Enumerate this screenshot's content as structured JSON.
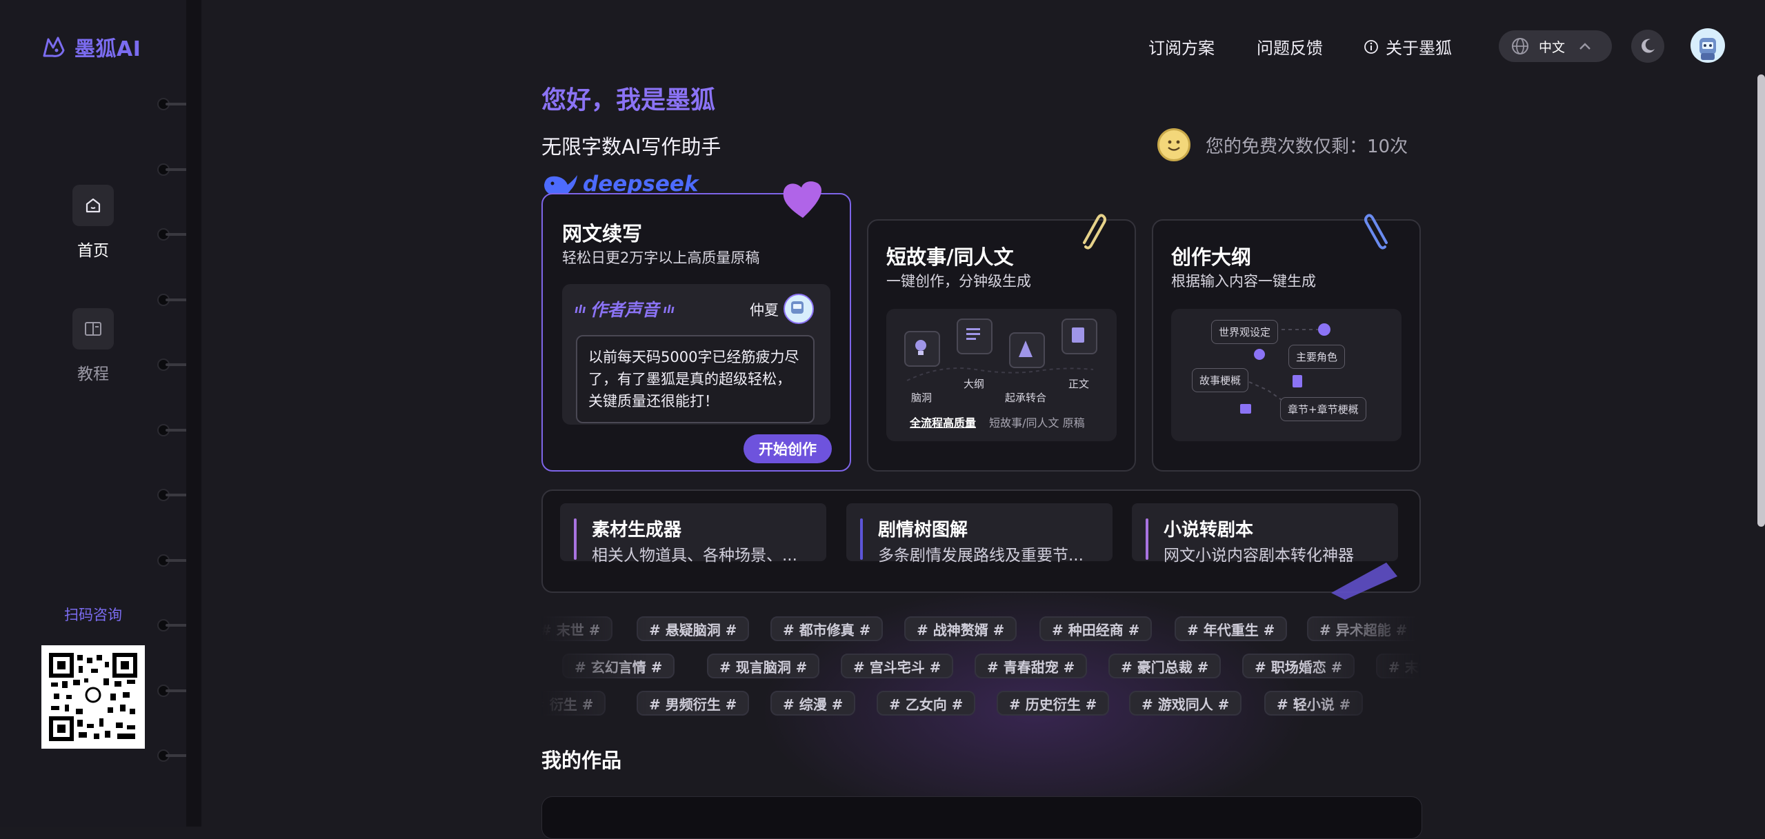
{
  "app": {
    "name": "墨狐AI"
  },
  "header": {
    "subscribe": "订阅方案",
    "feedback": "问题反馈",
    "about": "关于墨狐",
    "language": "中文"
  },
  "sidebar": {
    "items": [
      {
        "label": "首页",
        "icon": "home-icon",
        "active": true
      },
      {
        "label": "教程",
        "icon": "book-icon",
        "active": false
      }
    ],
    "qr_title": "扫码咨询"
  },
  "hero": {
    "greeting": "您好，我是墨狐",
    "subtitle": "无限字数AI写作助手",
    "free_prefix": "您的免费次数仅剩：",
    "free_count": "10次"
  },
  "cards": {
    "continue": {
      "badge": "deepseek",
      "title": "网文续写",
      "subtitle": "轻松日更2万字以上高质量原稿",
      "voice_label": "作者声音",
      "author": "仲夏",
      "quote": "以前每天码5000字已经筋疲力尽了，有了墨狐是真的超级轻松，关键质量还很能打！",
      "button": "开始创作"
    },
    "short": {
      "title": "短故事/同人文",
      "subtitle": "一键创作，分钟级生成",
      "steps": [
        "脑洞",
        "大纲",
        "起承转合",
        "正文"
      ],
      "footer_highlight": "全流程高质量",
      "footer_rest": "短故事/同人文 原稿"
    },
    "outline": {
      "title": "创作大纲",
      "subtitle": "根据输入内容一键生成",
      "nodes": [
        "世界观设定",
        "主要角色",
        "故事梗概",
        "章节+章节梗概"
      ]
    }
  },
  "tools": [
    {
      "title": "素材生成器",
      "desc": "相关人物道具、各种场景、..."
    },
    {
      "title": "剧情树图解",
      "desc": "多条剧情发展路线及重要节..."
    },
    {
      "title": "小说转剧本",
      "desc": "网文小说内容剧本转化神器"
    }
  ],
  "tag_rows": [
    [
      "# 末世 #",
      "# 悬疑脑洞 #",
      "# 都市修真 #",
      "# 战神赘婿 #",
      "# 种田经商 #",
      "# 年代重生 #",
      "# 异术超能 #"
    ],
    [
      "# 玄幻言情 #",
      "# 现言脑洞 #",
      "# 宫斗宅斗 #",
      "# 青春甜宠 #",
      "# 豪门总裁 #",
      "# 职场婚恋 #",
      "# 末世 #"
    ],
    [
      "# 衍生 #",
      "# 男频衍生 #",
      "# 综漫 #",
      "# 乙女向 #",
      "# 历史衍生 #",
      "# 游戏同人 #",
      "# 轻小说 #"
    ]
  ],
  "works": {
    "title": "我的作品"
  },
  "colors": {
    "accent": "#7b6cf0",
    "background": "#1b1a20",
    "card": "#16151b",
    "button": "#6e53dd"
  }
}
